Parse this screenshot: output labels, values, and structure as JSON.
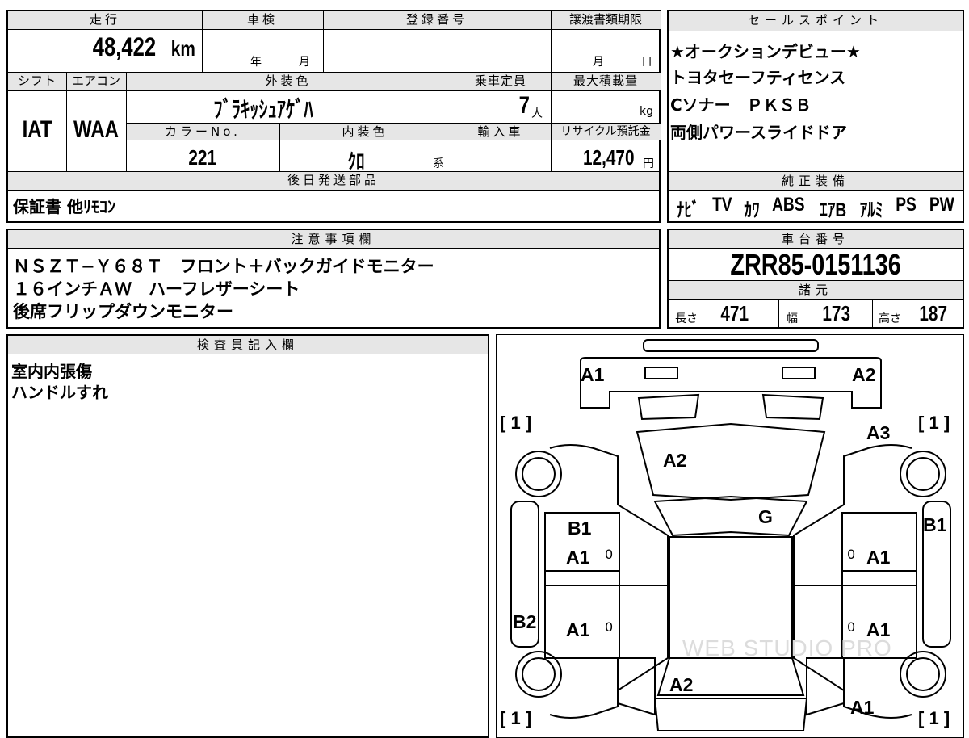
{
  "vehicle": {
    "mileage_label": "走行",
    "mileage": "48,422",
    "mileage_unit": "km",
    "inspection_label": "車検",
    "inspection_year_unit": "年",
    "inspection_month_unit": "月",
    "registration_label": "登録番号",
    "transfer_doc_label": "譲渡書類期限",
    "transfer_month_unit": "月",
    "transfer_day_unit": "日",
    "shift_label": "シフト",
    "shift": "IAT",
    "aircon_label": "エアコン",
    "aircon": "WAA",
    "exterior_color_label": "外装色",
    "exterior_color": "ﾌﾞﾗｷｯｼｭｱｹﾞﾊ",
    "capacity_label": "乗車定員",
    "capacity": "7",
    "capacity_unit": "人",
    "max_load_label": "最大積載量",
    "max_load_unit": "kg",
    "color_no_label": "カラーNo.",
    "color_no": "221",
    "interior_color_label": "内装色",
    "interior_color": "ｸﾛ",
    "interior_color_suffix": "系",
    "import_label": "輸入車",
    "recycle_label": "リサイクル預託金",
    "recycle_fee": "12,470",
    "recycle_unit": "円",
    "later_parts_label": "後日発送部品",
    "later_parts": "保証書 他ﾘﾓｺﾝ"
  },
  "sales_points": {
    "title": "セールスポイント",
    "lines": [
      "★オークションデビュー★",
      "トヨタセーフティセンス",
      "Cソナー　ＰＫＳＢ",
      "両側パワースライドドア"
    ]
  },
  "equipment": {
    "title": "純正装備",
    "items": [
      "ﾅﾋﾞ",
      "TV",
      "ｶﾜ",
      "ABS",
      "ｴｱB",
      "ｱﾙﾐ",
      "PS",
      "PW"
    ]
  },
  "notes": {
    "title": "注意事項欄",
    "lines": [
      "ＮＳＺＴ−Ｙ６８Ｔ　フロント＋バックガイドモニター",
      "１６インチＡＷ　ハーフレザーシート",
      "後席フリップダウンモニター"
    ]
  },
  "chassis": {
    "title": "車台番号",
    "number": "ZRR85-0151136",
    "spec_title": "諸元",
    "length_label": "長さ",
    "length": "471",
    "width_label": "幅",
    "width": "173",
    "height_label": "高さ",
    "height": "187"
  },
  "inspector": {
    "title": "検査員記入欄",
    "lines": [
      "室内内張傷",
      "ハンドルすれ"
    ]
  },
  "diagram": {
    "marks": {
      "front_left": "A1",
      "front_right": "A2",
      "hood": "A2",
      "right_front_fender": "A3",
      "windshield": "G",
      "left_front_door_upper": "B1",
      "left_front_door": "A1",
      "right_front_pillar": "B1",
      "right_front_door": "A1",
      "left_rear_quarter": "B2",
      "left_rear_door": "A1",
      "right_rear_door": "A1",
      "rear_gate": "A2",
      "right_rear": "A1"
    },
    "tire_tread": "1",
    "zero_mark": "0",
    "watermark": "WEB STUDIO PRO"
  }
}
